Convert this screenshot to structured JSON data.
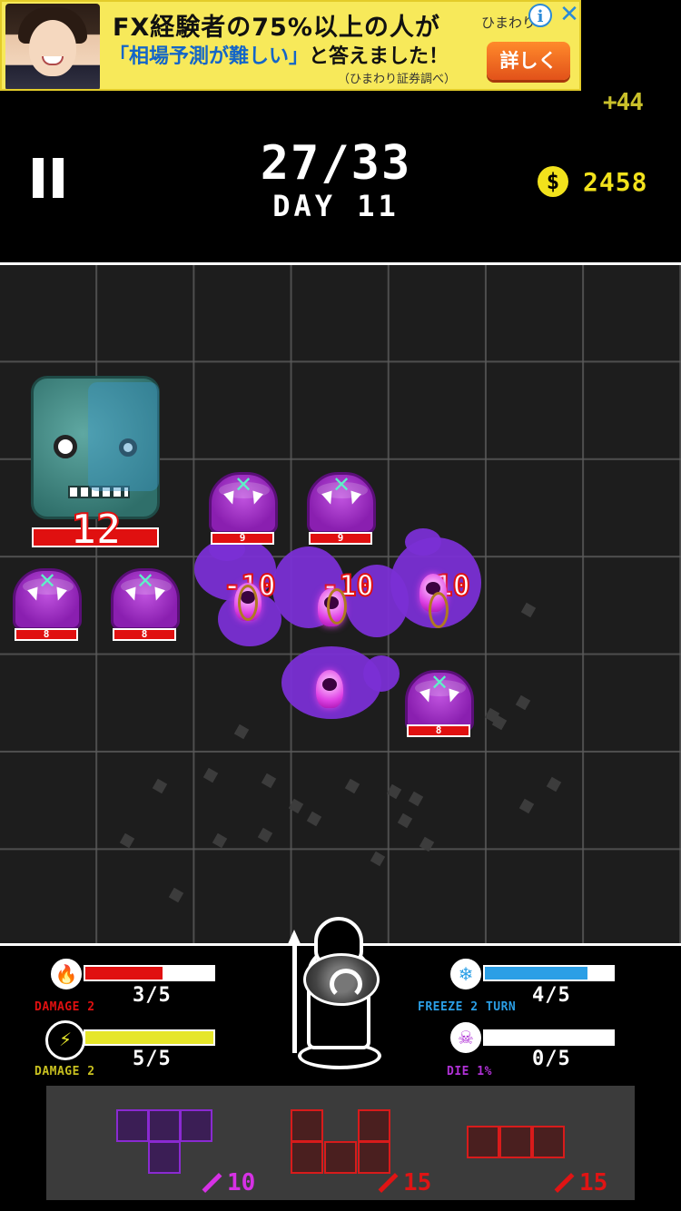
{
  "ad": {
    "line1": "FX経験者の75%以上の人が",
    "line2_highlight": "「相場予測が難しい」",
    "line2_rest": "と答えました！",
    "line3": "（ひまわり証券調べ）",
    "brand": "ひまわり",
    "cta": "詳しく",
    "info_icon": "info-icon",
    "close_icon": "close-icon"
  },
  "header": {
    "score_popup": "+44",
    "turn_counter": "27/33",
    "day_label": "DAY 11",
    "coins": "2458",
    "coin_symbol": "$"
  },
  "board": {
    "boss_hp": "12",
    "enemies": [
      {
        "id": "slime-1",
        "hp": "9"
      },
      {
        "id": "slime-2",
        "hp": "9"
      },
      {
        "id": "slime-3",
        "hp": "8"
      },
      {
        "id": "slime-4",
        "hp": "8"
      },
      {
        "id": "slime-5",
        "hp": "8"
      }
    ],
    "damage_popups": [
      "-10",
      "-10",
      "-10"
    ]
  },
  "stats": {
    "fire": {
      "value": "3/5",
      "caption": "DAMAGE 2",
      "fill": 0.6,
      "color": "#e01010",
      "icon": "fire-icon"
    },
    "lightning": {
      "value": "5/5",
      "caption": "DAMAGE 2",
      "fill": 1.0,
      "color": "#e6e62a",
      "icon": "lightning-icon"
    },
    "freeze": {
      "value": "4/5",
      "caption": "FREEZE 2 TURN",
      "fill": 0.8,
      "color": "#2b9fe6",
      "icon": "snowflake-icon"
    },
    "poison": {
      "value": "0/5",
      "caption": "DIE 1%",
      "fill": 0.0,
      "color": "#b031d6",
      "icon": "skull-icon"
    }
  },
  "pieces": [
    {
      "color": "purple",
      "price": "10"
    },
    {
      "color": "red",
      "price": "15"
    },
    {
      "color": "red",
      "price": "15"
    }
  ],
  "colors": {
    "coin": "#f2e21c",
    "hp_red": "#e01010",
    "fire_caption": "#e01010",
    "lightning_caption": "#c8c020",
    "freeze_caption": "#2b9fe6",
    "poison_caption": "#b031d6"
  }
}
